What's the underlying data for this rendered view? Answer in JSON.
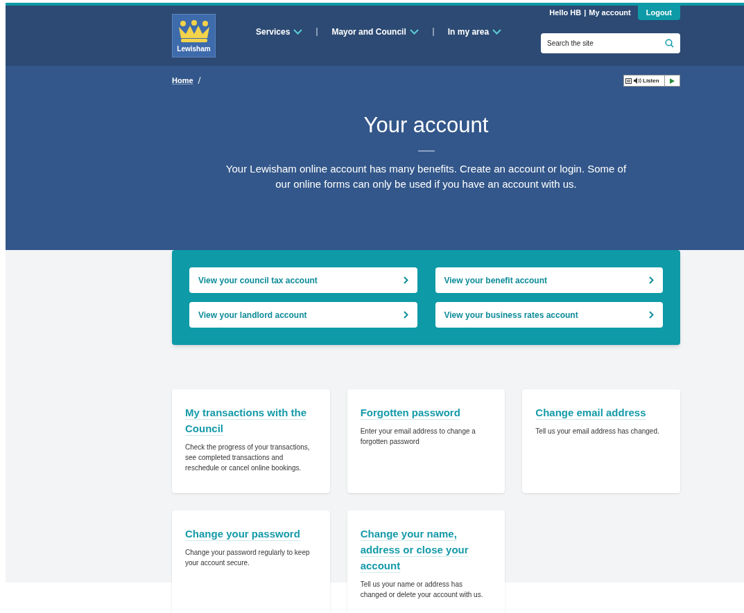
{
  "header": {
    "logo_text": "Lewisham",
    "greeting": "Hello HB",
    "separator": "|",
    "account_link": "My account",
    "logout": "Logout",
    "nav": [
      {
        "label": "Services"
      },
      {
        "label": "Mayor and Council"
      },
      {
        "label": "In my area"
      }
    ],
    "search": {
      "placeholder": "Search the site"
    }
  },
  "breadcrumb": [
    {
      "label": "Home"
    }
  ],
  "listen": {
    "label": "Listen"
  },
  "hero": {
    "title": "Your account",
    "intro": "Your Lewisham online account has many benefits. Create an account or login. Some of our online forms can only be used if you have an account with us."
  },
  "quick_links": [
    {
      "label": "View your council tax account"
    },
    {
      "label": "View your benefit account"
    },
    {
      "label": "View your landlord account"
    },
    {
      "label": "View your business rates account"
    }
  ],
  "cards": [
    {
      "title": "My transactions with the Council",
      "text": "Check the progress of your transactions, see completed transactions and reschedule or cancel online bookings."
    },
    {
      "title": "Forgotten password",
      "text": "Enter your email address to change a forgotten password"
    },
    {
      "title": "Change email address",
      "text": "Tell us your email address has changed."
    },
    {
      "title": "Change your password",
      "text": "Change your password regularly to keep your account secure."
    },
    {
      "title": "Change your name, address or close your account",
      "text": "Tell us your name or address has changed or delete your account with us."
    }
  ]
}
